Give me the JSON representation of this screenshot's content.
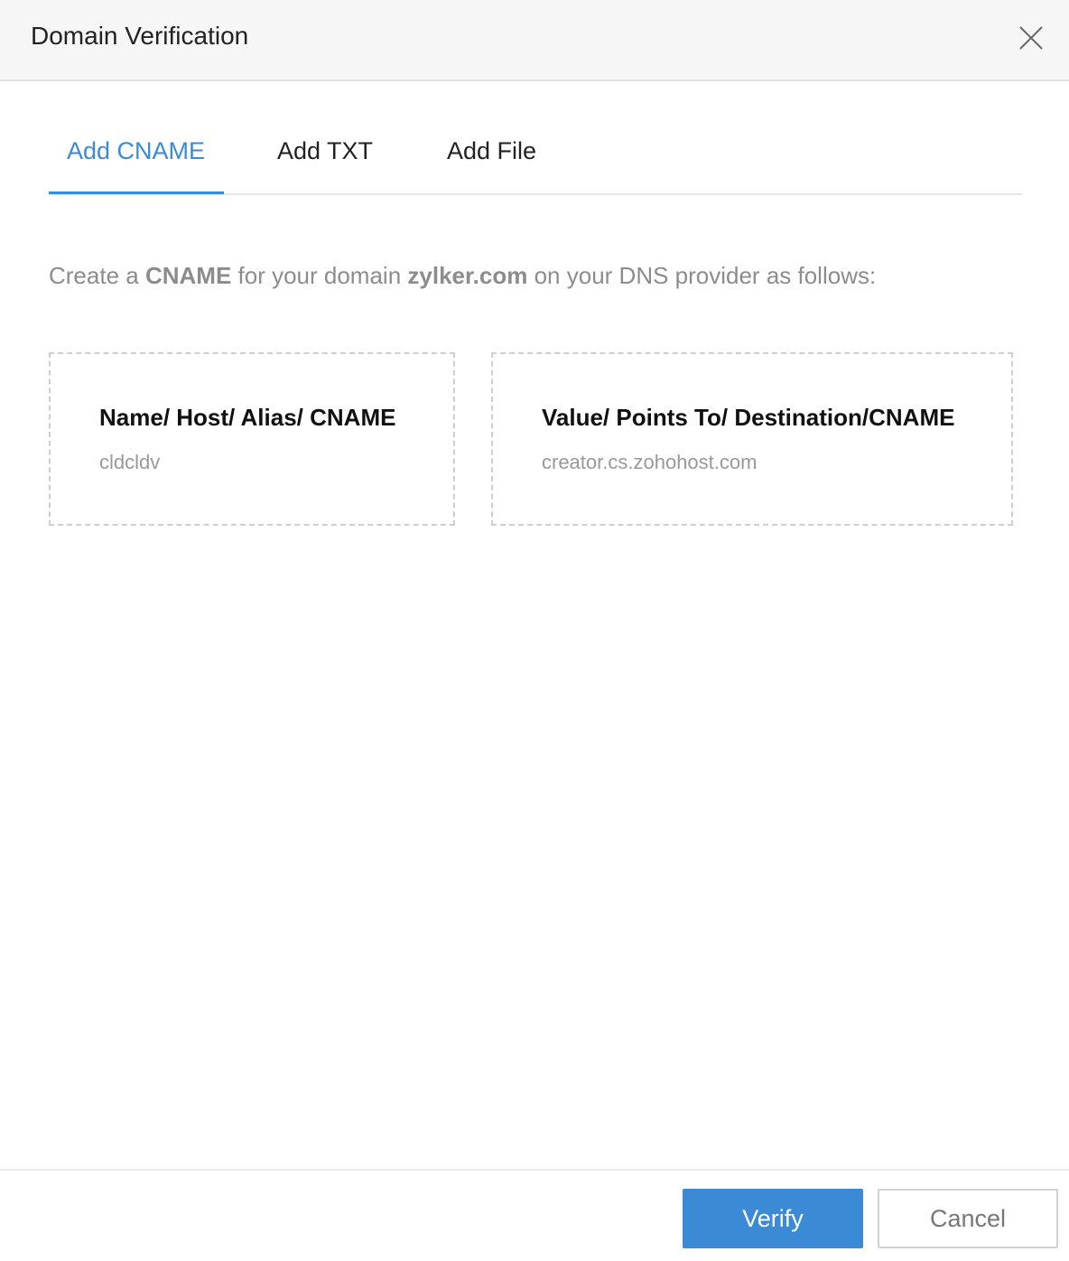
{
  "dialog": {
    "title": "Domain Verification"
  },
  "tabs": [
    {
      "label": "Add CNAME",
      "active": true
    },
    {
      "label": "Add TXT",
      "active": false
    },
    {
      "label": "Add File",
      "active": false
    }
  ],
  "instruction": {
    "prefix": "Create a ",
    "record_type": "CNAME",
    "middle": " for your domain ",
    "domain": "zylker.com",
    "suffix": " on your DNS provider as follows:"
  },
  "cards": [
    {
      "title": "Name/ Host/ Alias/ CNAME",
      "value": "cldcldv"
    },
    {
      "title": "Value/ Points To/ Destination/CNAME",
      "value": "creator.cs.zohohost.com"
    }
  ],
  "footer": {
    "verify_label": "Verify",
    "cancel_label": "Cancel"
  },
  "colors": {
    "accent": "#3a8ad6",
    "header_bg": "#f6f6f6",
    "muted_text": "#8c8c8c"
  },
  "icons": {
    "close": "close-icon"
  }
}
